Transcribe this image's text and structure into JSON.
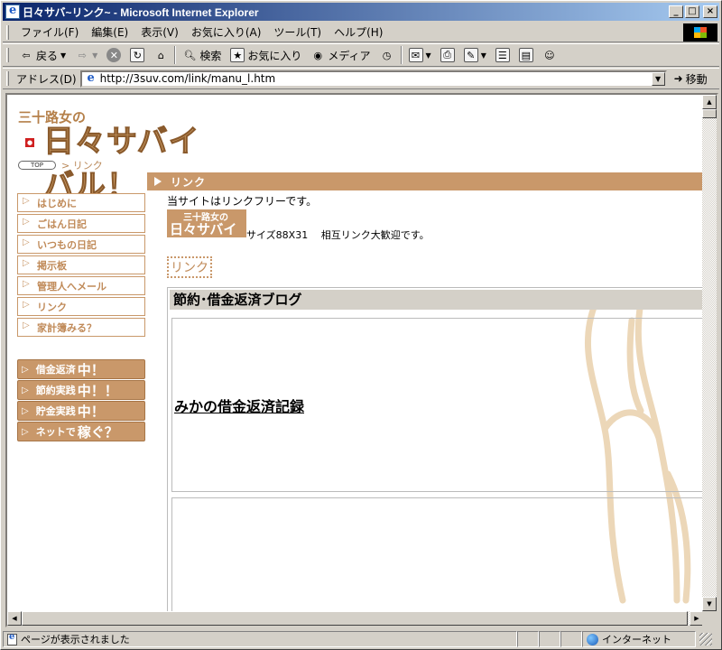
{
  "window": {
    "title": "日々サバ~リンク~ - Microsoft Internet Explorer",
    "min_label": "_",
    "max_label": "□",
    "close_label": "×"
  },
  "menubar": {
    "items": [
      "ファイル(F)",
      "編集(E)",
      "表示(V)",
      "お気に入り(A)",
      "ツール(T)",
      "ヘルプ(H)"
    ]
  },
  "toolbar": {
    "back_label": "戻る",
    "search_label": "検索",
    "favorites_label": "お気に入り",
    "media_label": "メディア"
  },
  "address": {
    "label": "アドレス(D)",
    "url": "http://3suv.com/link/manu_l.htm",
    "go_label": "移動"
  },
  "page": {
    "logo_small": "三十路女の",
    "logo_big": "日々サバイバル！",
    "top_button": "TOP",
    "breadcrumb": "> リンク",
    "section_title": "リンク",
    "nav_items": [
      "はじめに",
      "ごはん日記",
      "いつもの日記",
      "掲示板",
      "管理人へメール",
      "リンク",
      "家計簿みる？"
    ],
    "nav_buttons": [
      {
        "main": "借金返済",
        "em": "中！"
      },
      {
        "main": "節約実践",
        "em": "中！！"
      },
      {
        "main": "貯金実践",
        "em": "中！"
      },
      {
        "main": "ネットで",
        "em": "稼ぐ？"
      }
    ],
    "intro_text": "当サイトはリンクフリーです。",
    "banner_line1": "三十路女の",
    "banner_line2": "日々サバイバル！",
    "size_note": "サイズ88X31　 相互リンク大歓迎です。",
    "link_heading": "リンク",
    "category_title": "節約･借金返済ブログ",
    "blog_link": "みかの借金返済記録"
  },
  "status": {
    "text": "ページが表示されました",
    "zone": "インターネット"
  },
  "colors": {
    "accent": "#c9986a",
    "titlebar_start": "#0a246a",
    "titlebar_end": "#a6caf0"
  }
}
